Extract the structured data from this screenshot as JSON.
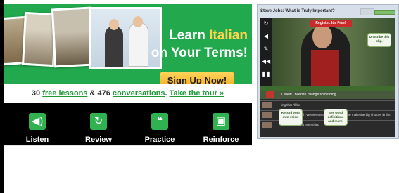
{
  "banner": {
    "headline_line1": "Learn",
    "language": "Italian",
    "headline_line2": "on Your Terms!",
    "signup_label": "Sign Up Now!",
    "stats": {
      "lessons_count": "30",
      "lessons_link": "free lessons",
      "amp": "&",
      "conversations_count": "476",
      "conversations_link": "conversations",
      "tour_link": "Take the tour »"
    },
    "features": [
      {
        "label": "Listen",
        "icon": "speaker-icon"
      },
      {
        "label": "Review",
        "icon": "review-icon"
      },
      {
        "label": "Practice",
        "icon": "speech-bubble-icon"
      },
      {
        "label": "Reinforce",
        "icon": "lock-icon"
      }
    ]
  },
  "player": {
    "title": "Steve Jobs: What is Truly Important?",
    "register_label": "Register. It's Free!",
    "bubble_video": "Unscribe this clip.",
    "current_line": "I knew I need to change something",
    "rows": [
      "ing that I'll be",
      "st important tool I've ever encountered to help me make the big choices in life.",
      "Because almost everything"
    ],
    "bubble_record": "Record your own voice.",
    "bubble_definitions": "See word definitions and more.",
    "colors": {
      "accent_green": "#22a94d",
      "signup_orange": "#f4a81c",
      "register_red": "#cc2a2a"
    }
  }
}
